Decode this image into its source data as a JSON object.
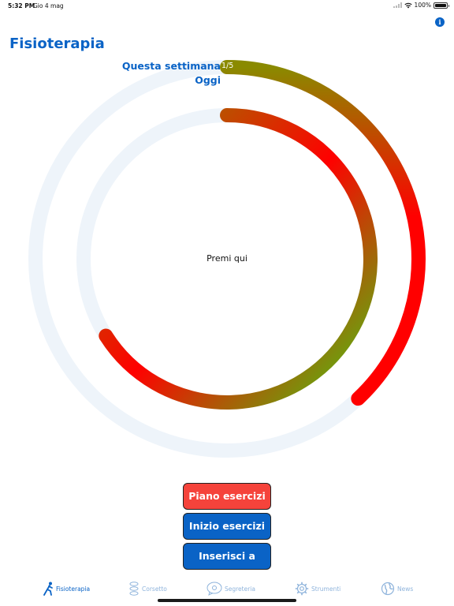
{
  "status": {
    "time": "5:32 PM",
    "date": "Gio 4 mag",
    "battery": "100%"
  },
  "header": {
    "title": "Fisioterapia"
  },
  "rings": {
    "week_label": "Questa settimana",
    "week_count": "1/5",
    "day_label": "Oggi",
    "center_text": "Premi qui",
    "week_progress": 0.38,
    "day_progress": 0.66,
    "track_color": "#eef4fa",
    "start_color": "#8a8a00",
    "mid_color": "#ff0000",
    "end_color": "#44cc11"
  },
  "actions": {
    "plan_label": "Piano esercizi",
    "start_label": "Inizio esercizi",
    "manual_label": "Inserisci a mano",
    "plan_color": "#f5433b",
    "primary_color": "#0a63c6"
  },
  "tabs": [
    {
      "label": "Fisioterapia",
      "icon": "runner-icon",
      "active": true
    },
    {
      "label": "Corsetto",
      "icon": "spine-icon",
      "active": false
    },
    {
      "label": "Segreteria",
      "icon": "chat-icon",
      "active": false
    },
    {
      "label": "Strumenti",
      "icon": "gear-icon",
      "active": false
    },
    {
      "label": "News",
      "icon": "globe-icon",
      "active": false
    }
  ]
}
